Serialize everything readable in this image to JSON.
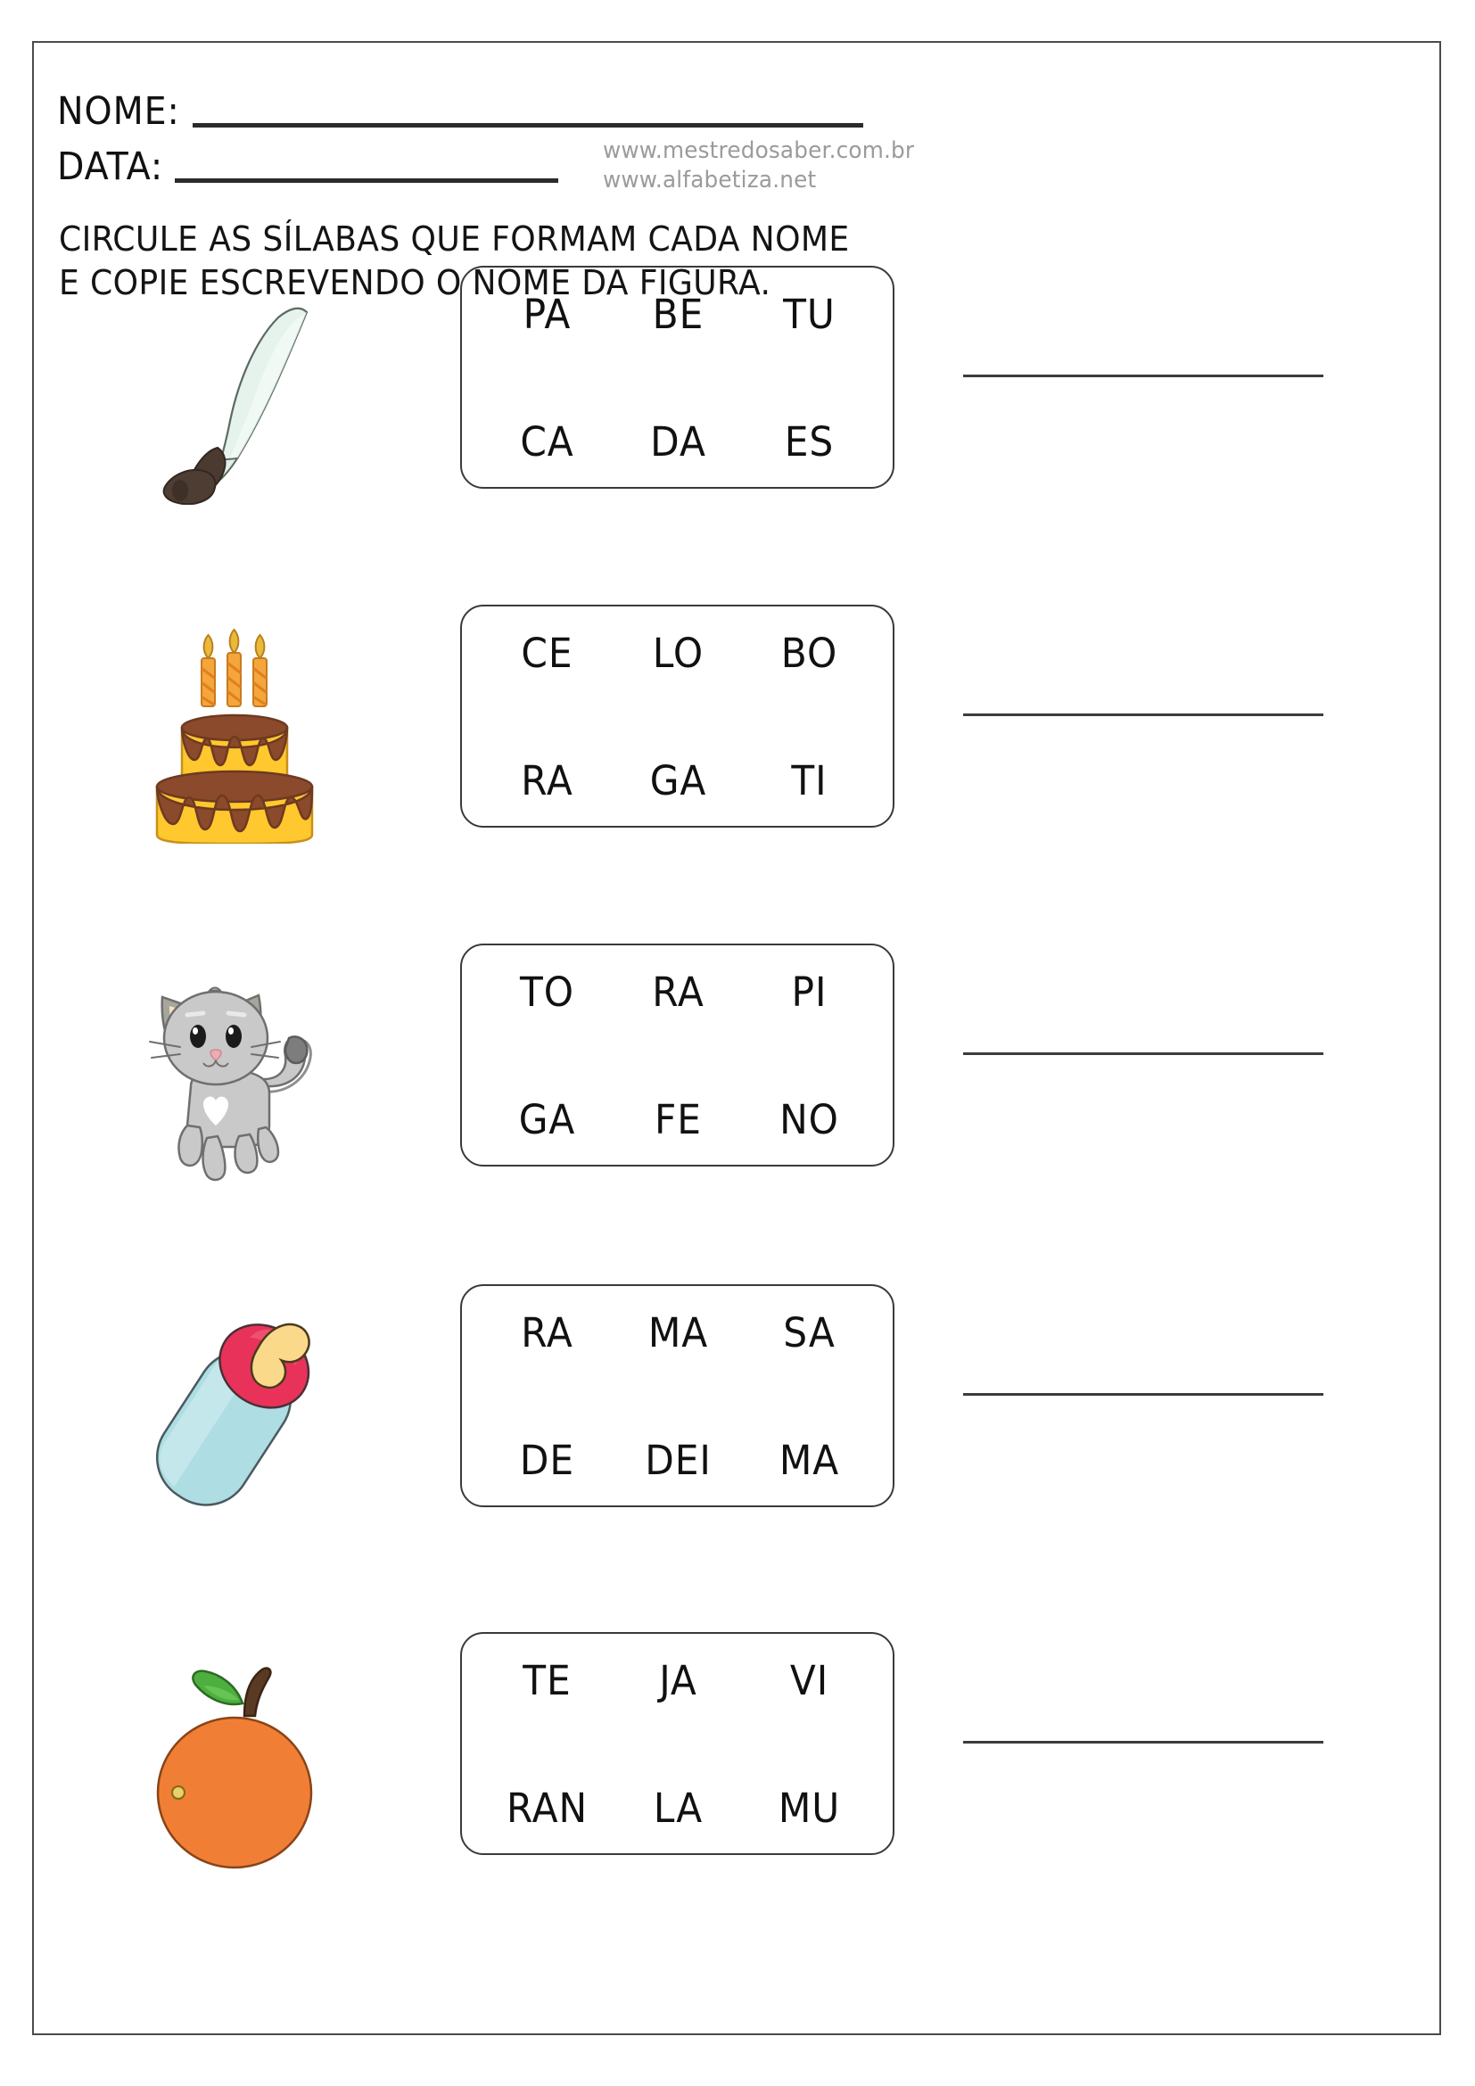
{
  "header": {
    "nome_label": "NOME:",
    "data_label": "DATA:",
    "site_1": "www.mestredosaber.com.br",
    "site_2": "www.alfabetiza.net"
  },
  "instruction": "CIRCULE AS SÍLABAS QUE FORMAM CADA NOME E COPIE ESCREVENDO O NOME DA FIGURA.",
  "colors": {
    "page_border": "#4b4b4b",
    "text": "#111111",
    "site_text": "#9b9b9b",
    "box_border": "#3a3a3a",
    "rule": "#2b2b2b"
  },
  "exercises": [
    {
      "picture": "sword-icon",
      "picture_label": "espada",
      "syllables": [
        "PA",
        "BE",
        "TU",
        "CA",
        "DA",
        "ES"
      ],
      "answer_line": ""
    },
    {
      "picture": "cake-icon",
      "picture_label": "bolo",
      "syllables": [
        "CE",
        "LO",
        "BO",
        "RA",
        "GA",
        "TI"
      ],
      "answer_line": ""
    },
    {
      "picture": "cat-icon",
      "picture_label": "gato",
      "syllables": [
        "TO",
        "RA",
        "PI",
        "GA",
        "FE",
        "NO"
      ],
      "answer_line": ""
    },
    {
      "picture": "baby-bottle-icon",
      "picture_label": "mamadeira",
      "syllables": [
        "RA",
        "MA",
        "SA",
        "DE",
        "DEI",
        "MA"
      ],
      "answer_line": ""
    },
    {
      "picture": "orange-icon",
      "picture_label": "laranja",
      "syllables": [
        "TE",
        "JA",
        "VI",
        "RAN",
        "LA",
        "MU"
      ],
      "answer_line": ""
    }
  ]
}
